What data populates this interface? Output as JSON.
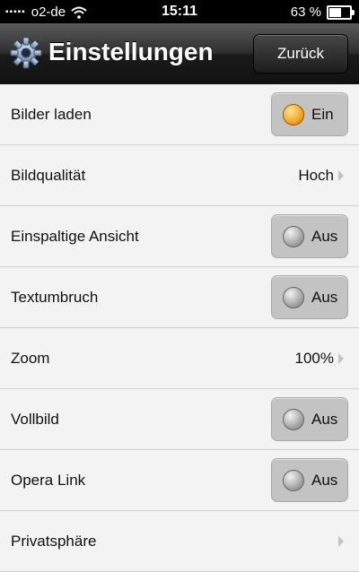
{
  "status_bar": {
    "carrier": "o2-de",
    "time": "15:11",
    "battery_percent": "63 %",
    "battery_level": 0.63
  },
  "header": {
    "title": "Einstellungen",
    "back_label": "Zurück",
    "icon": "gear-icon"
  },
  "settings": [
    {
      "label": "Bilder laden",
      "type": "toggle",
      "state": "on",
      "value": "Ein"
    },
    {
      "label": "Bildqualität",
      "type": "value",
      "value": "Hoch"
    },
    {
      "label": "Einspaltige Ansicht",
      "type": "toggle",
      "state": "off",
      "value": "Aus"
    },
    {
      "label": "Textumbruch",
      "type": "toggle",
      "state": "off",
      "value": "Aus"
    },
    {
      "label": "Zoom",
      "type": "value",
      "value": "100%"
    },
    {
      "label": "Vollbild",
      "type": "toggle",
      "state": "off",
      "value": "Aus"
    },
    {
      "label": "Opera Link",
      "type": "toggle",
      "state": "off",
      "value": "Aus"
    },
    {
      "label": "Privatsphäre",
      "type": "value",
      "value": ""
    }
  ],
  "colors": {
    "toggle_on": "#f1a21a",
    "toggle_off": "#9a9a9a",
    "header_bg": "#2f2f2f"
  }
}
